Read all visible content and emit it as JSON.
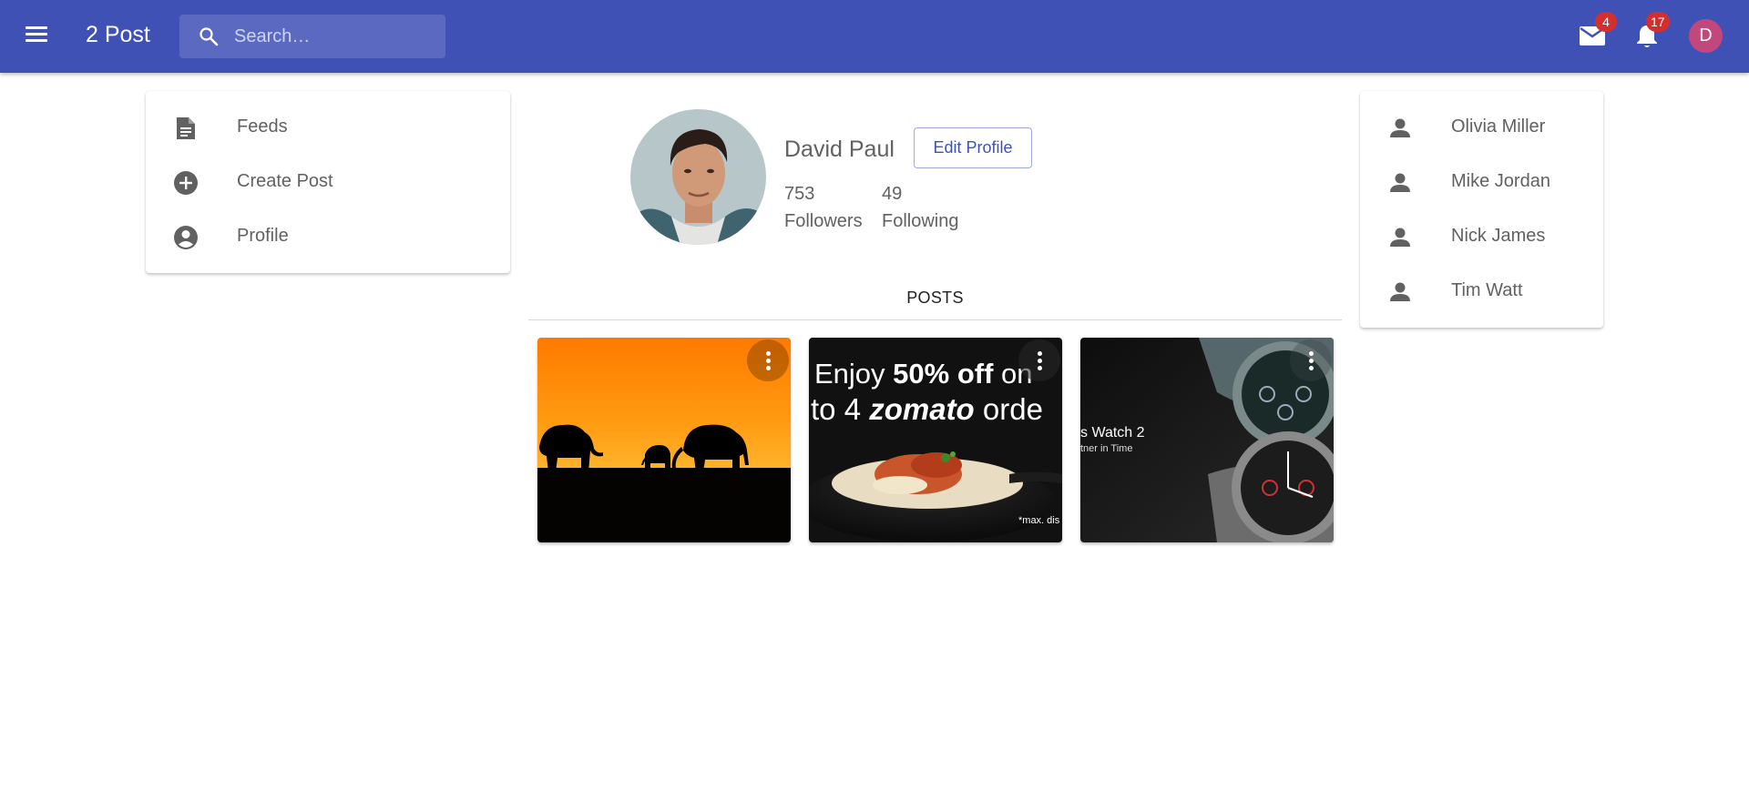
{
  "header": {
    "app_title": "2 Post",
    "search_placeholder": "Search…",
    "mail_badge": "4",
    "notification_badge": "17",
    "avatar_initial": "D",
    "color": "#3f51b5"
  },
  "sidebar": {
    "items": [
      {
        "label": "Feeds",
        "icon": "article-icon"
      },
      {
        "label": "Create Post",
        "icon": "add-circle-icon"
      },
      {
        "label": "Profile",
        "icon": "account-circle-icon"
      }
    ]
  },
  "profile": {
    "name": "David Paul",
    "edit_label": "Edit Profile",
    "followers_count": "753",
    "followers_label": "Followers",
    "following_count": "49",
    "following_label": "Following"
  },
  "posts": {
    "header": "POSTS",
    "items": [
      {
        "image": "elephants-sunset"
      },
      {
        "image": "zomato-ad",
        "text_line1_prefix": "Enjoy ",
        "text_bold": "50% off",
        "text_line1_suffix": " on",
        "text_line2_prefix": "to 4 ",
        "text_brand": "zomato",
        "text_line2_suffix": " orde",
        "footnote": "*max. dis"
      },
      {
        "image": "watch-ad",
        "title": "s Watch 2",
        "subtitle": "tner in Time"
      }
    ]
  },
  "following_list": {
    "items": [
      {
        "name": "Olivia Miller"
      },
      {
        "name": "Mike Jordan"
      },
      {
        "name": "Nick James"
      },
      {
        "name": "Tim Watt"
      }
    ]
  }
}
